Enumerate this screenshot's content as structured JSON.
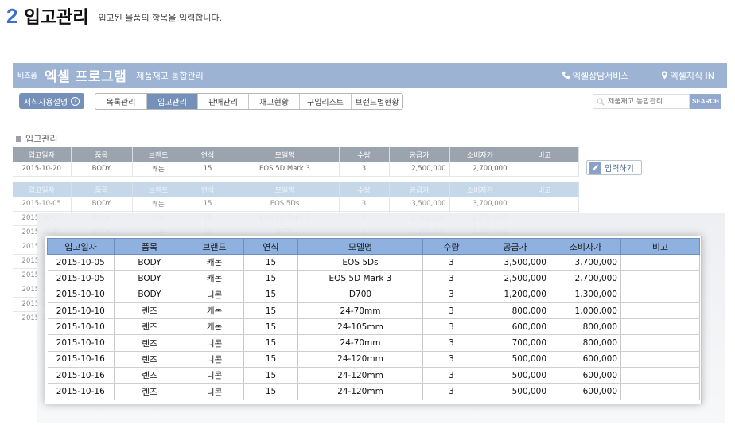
{
  "heading": {
    "number": "2",
    "title": "입고관리",
    "desc": "입고된 물품의 항목을 입력합니다."
  },
  "appbar": {
    "logo_small": "비즈폼",
    "title": "엑셀 프로그램",
    "subtitle": "제품재고 통합관리",
    "links": [
      {
        "label": "엑셀상담서비스",
        "icon": "phone-icon"
      },
      {
        "label": "엑셀지식 IN",
        "icon": "location-pin-icon"
      }
    ]
  },
  "nav": {
    "guide_label": "서식사용설명",
    "tabs": [
      "목록관리",
      "입고관리",
      "판매관리",
      "재고현황",
      "구입리스트",
      "브랜드별현황"
    ],
    "active_tab": 1,
    "search_placeholder": "제품재고 통합관리",
    "search_button": "SEARCH"
  },
  "section_label": "입고관리",
  "columns": [
    "입고일자",
    "품목",
    "브랜드",
    "연식",
    "모델명",
    "수량",
    "공급가",
    "소비자가",
    "비고"
  ],
  "input_form": {
    "row": [
      "2015-10-20",
      "BODY",
      "캐논",
      "15",
      "EOS 5D Mark 3",
      "3",
      "2,500,000",
      "2,700,000",
      ""
    ],
    "button_label": "입력하기"
  },
  "list_rows": [
    [
      "2015-10-05",
      "BODY",
      "캐논",
      "15",
      "EOS 5Ds",
      "3",
      "3,500,000",
      "3,700,000",
      ""
    ],
    [
      "2015-10-05",
      "BODY",
      "캐논",
      "15",
      "EOS 5D Mark 3",
      "3",
      "2,500,000",
      "2,700,000",
      ""
    ],
    [
      "2015-10-10",
      "BODY",
      "니콘",
      "15",
      "D700",
      "3",
      "1,200,000",
      "1,300,000",
      ""
    ],
    [
      "2015-10-10",
      "렌즈",
      "캐논",
      "15",
      "24-70mm",
      "3",
      "800,000",
      "1,000,000",
      ""
    ],
    [
      "2015-10-10",
      "렌즈",
      "캐논",
      "15",
      "24-105mm",
      "3",
      "600,000",
      "800,000",
      ""
    ],
    [
      "2015-10-10",
      "렌즈",
      "니콘",
      "15",
      "24-70mm",
      "3",
      "700,000",
      "800,000",
      ""
    ],
    [
      "2015-10-16",
      "렌즈",
      "니콘",
      "15",
      "24-120mm",
      "3",
      "500,000",
      "600,000",
      ""
    ],
    [
      "2015-10-16",
      "렌즈",
      "니콘",
      "15",
      "24-120mm",
      "3",
      "500,000",
      "600,000",
      ""
    ],
    [
      "2015-10-16",
      "렌즈",
      "니콘",
      "15",
      "24-120mm",
      "3",
      "500,000",
      "600,000",
      ""
    ]
  ],
  "colors": {
    "accent": "#3d6fd1",
    "appbar": "#9db3d3",
    "active_tab": "#7590b9",
    "zoom_header": "#8fb1df"
  }
}
